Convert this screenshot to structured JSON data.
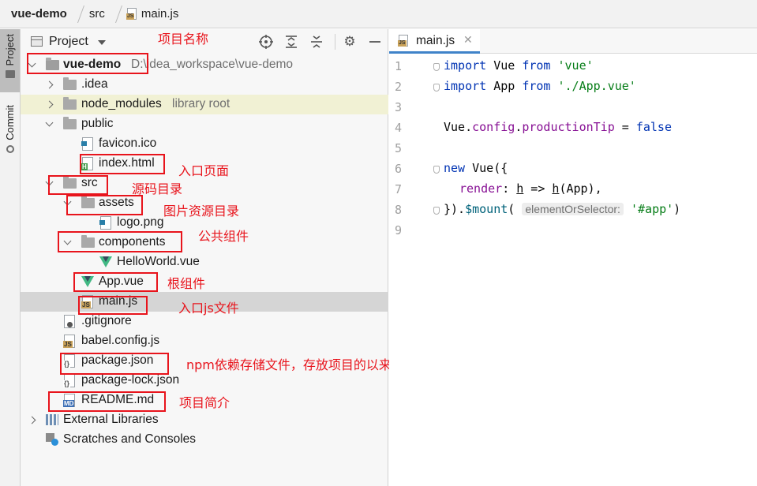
{
  "breadcrumb": {
    "project": "vue-demo",
    "folder": "src",
    "file": "main.js"
  },
  "tool_strip": {
    "project_tab": "Project",
    "commit_tab": "Commit"
  },
  "project_panel": {
    "title": "Project",
    "tree": {
      "root_name": "vue-demo",
      "root_path": "D:\\idea_workspace\\vue-demo",
      "idea": ".idea",
      "node_modules": "node_modules",
      "node_modules_hint": "library root",
      "public": "public",
      "favicon": "favicon.ico",
      "index_html": "index.html",
      "src": "src",
      "assets": "assets",
      "logo": "logo.png",
      "components": "components",
      "hello_world": "HelloWorld.vue",
      "app_vue": "App.vue",
      "main_js": "main.js",
      "gitignore": ".gitignore",
      "babel": "babel.config.js",
      "package_json": "package.json",
      "package_lock": "package-lock.json",
      "readme": "README.md",
      "external_libraries": "External Libraries",
      "scratches": "Scratches and Consoles"
    }
  },
  "annotations": {
    "project_name": "项目名称",
    "entry_page": "入口页面",
    "source_dir": "源码目录",
    "image_dir": "图片资源目录",
    "common_components": "公共组件",
    "root_component": "根组件",
    "entry_js": "入口js文件",
    "npm_deps": "npm依赖存储文件，存放项目的以来信息",
    "readme_desc": "项目简介"
  },
  "editor": {
    "tab_label": "main.js",
    "line_numbers": [
      "1",
      "2",
      "3",
      "4",
      "5",
      "6",
      "7",
      "8",
      "9"
    ],
    "code": {
      "l1_kw1": "import",
      "l1_mid": " Vue ",
      "l1_kw2": "from",
      "l1_str": " 'vue'",
      "l2_kw1": "import",
      "l2_mid": " App ",
      "l2_kw2": "from",
      "l2_str": " './App.vue'",
      "l4_a": "Vue.",
      "l4_prop": "config",
      "l4_b": ".",
      "l4_prop2": "productionTip",
      "l4_c": " = ",
      "l4_kw": "false",
      "l6_kw": "new",
      "l6_rest": " Vue({",
      "l7_prop": "render",
      "l7_a": ": ",
      "l7_h1": "h",
      "l7_b": " => ",
      "l7_h2": "h",
      "l7_c": "(App),",
      "l8_a": "}).",
      "l8_fn": "$mount",
      "l8_b": "( ",
      "l8_hint": "elementOrSelector:",
      "l8_str": " '#app'",
      "l8_c": ")"
    }
  },
  "colors": {
    "annotation_red": "#e8141c",
    "selection": "#d5d5d5",
    "library_bg": "#f1f1d4",
    "keyword": "#0033b3",
    "string": "#067d17"
  }
}
